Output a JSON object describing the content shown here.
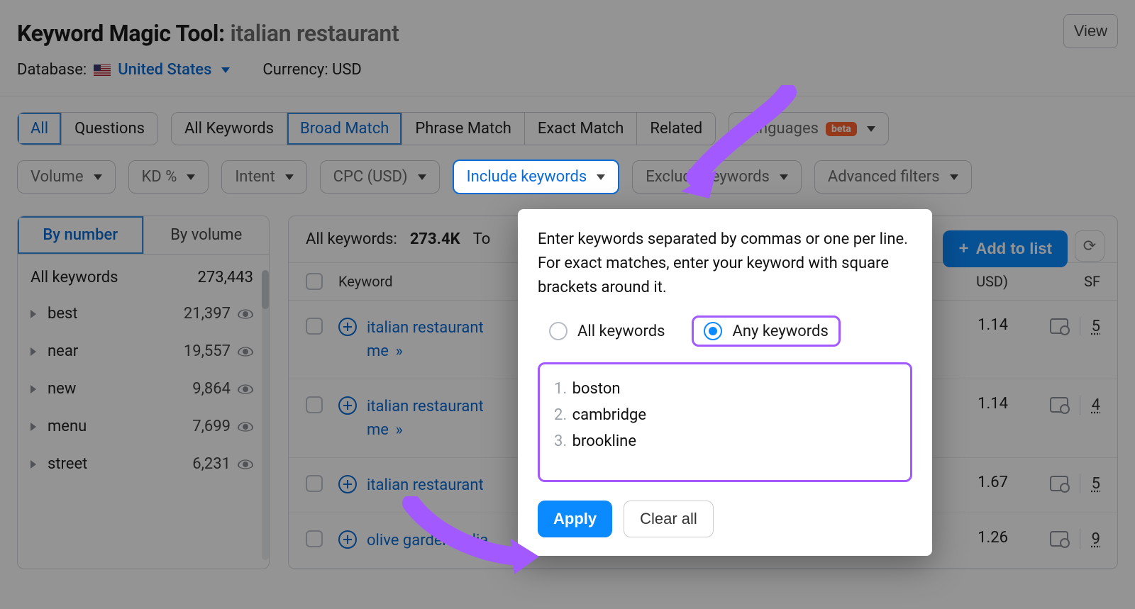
{
  "header": {
    "title_prefix": "Keyword Magic Tool:",
    "query": "italian restaurant",
    "view_button": "View",
    "db_label": "Database:",
    "db_country": "United States",
    "currency_label": "Currency: USD"
  },
  "tabs": {
    "group1": [
      "All",
      "Questions"
    ],
    "group2": [
      "All Keywords",
      "Broad Match",
      "Phrase Match",
      "Exact Match",
      "Related"
    ],
    "languages_label": "Languages",
    "beta": "beta"
  },
  "filters": {
    "volume": "Volume",
    "kd": "KD %",
    "intent": "Intent",
    "cpc": "CPC (USD)",
    "include": "Include keywords",
    "exclude": "Exclude keywords",
    "advanced": "Advanced filters"
  },
  "sidebar": {
    "tab_number": "By number",
    "tab_volume": "By volume",
    "all_label": "All keywords",
    "all_count": "273,443",
    "items": [
      {
        "name": "best",
        "count": "21,397"
      },
      {
        "name": "near",
        "count": "19,557"
      },
      {
        "name": "new",
        "count": "9,864"
      },
      {
        "name": "menu",
        "count": "7,699"
      },
      {
        "name": "street",
        "count": "6,231"
      }
    ]
  },
  "results": {
    "prefix": "All keywords:",
    "count_abbrev": "273.4K",
    "total_prefix": "To",
    "add_to_list": "Add to list",
    "col_keyword": "Keyword",
    "col_cpc": "USD)",
    "col_sf": "SF",
    "rows": [
      {
        "kw_line1": "italian restaurant",
        "kw_line2": "me",
        "cpc": "1.14",
        "sf": "5"
      },
      {
        "kw_line1": "italian restaurant",
        "kw_line2": "me",
        "cpc": "1.14",
        "sf": "4"
      },
      {
        "kw_line1": "italian restaurant",
        "kw_line2": "",
        "cpc": "1.67",
        "sf": "5"
      },
      {
        "kw_line1": "olive garden italia",
        "kw_line2": "",
        "cpc": "1.26",
        "sf": "9"
      }
    ]
  },
  "popover": {
    "instructions": "Enter keywords separated by commas or one per line. For exact matches, enter your keyword with square brackets around it.",
    "radio_all": "All keywords",
    "radio_any": "Any keywords",
    "entries": [
      "boston",
      "cambridge",
      "brookline"
    ],
    "apply": "Apply",
    "clear_all": "Clear all"
  }
}
